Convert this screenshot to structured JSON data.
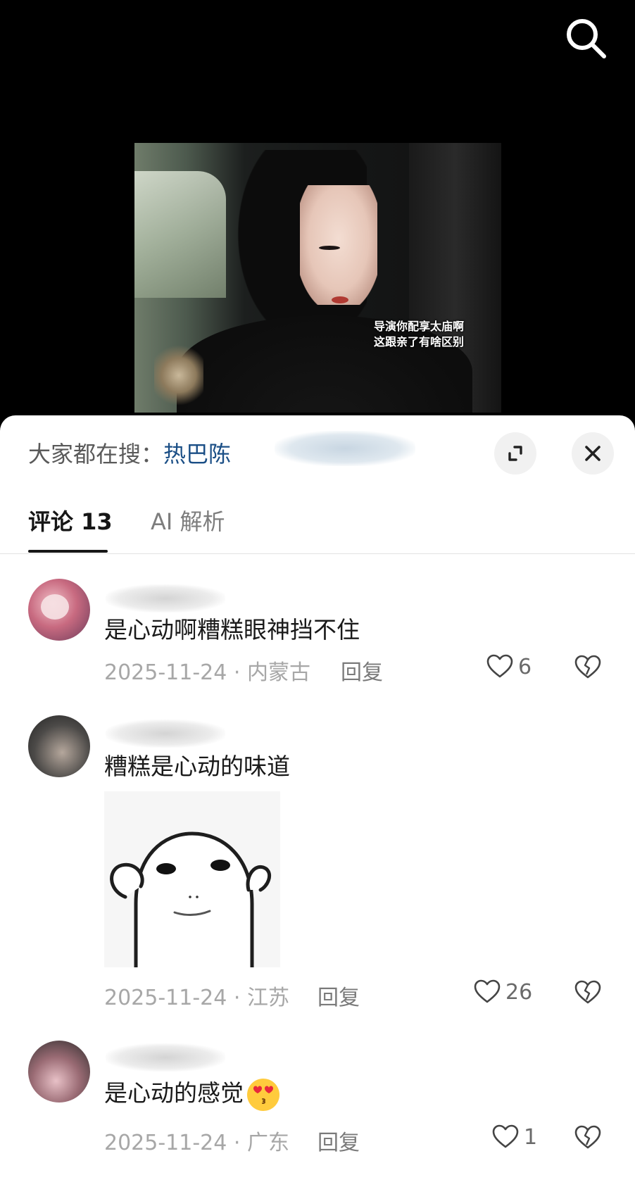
{
  "video": {
    "subtitle_line1": "导演你配享太庙啊",
    "subtitle_line2": "这跟亲了有啥区别"
  },
  "panel": {
    "hot_search_prefix": "大家都在搜：",
    "hot_search_term": "热巴陈"
  },
  "tabs": [
    {
      "label": "评论 13",
      "active": true
    },
    {
      "label": "AI 解析",
      "active": false
    }
  ],
  "comments": [
    {
      "text": "是心动啊糟糕眼神挡不住",
      "date": "2025-11-24",
      "location": "内蒙古",
      "reply_label": "回复",
      "likes": "6"
    },
    {
      "text": "糟糕是心动的味道",
      "date": "2025-11-24",
      "location": "江苏",
      "reply_label": "回复",
      "likes": "26",
      "has_sticker": true
    },
    {
      "text": "是心动的感觉",
      "date": "2025-11-24",
      "location": "广东",
      "reply_label": "回复",
      "likes": "1",
      "emoji": "heart-eyes-kiss"
    }
  ],
  "meta_separator": " · ",
  "colors": {
    "accent_blue": "#1b4f86",
    "text_primary": "#1a1a1a",
    "text_muted": "#a7a7a7"
  },
  "icons": [
    "search-icon",
    "expand-icon",
    "close-icon",
    "heart-icon",
    "broken-heart-icon"
  ]
}
